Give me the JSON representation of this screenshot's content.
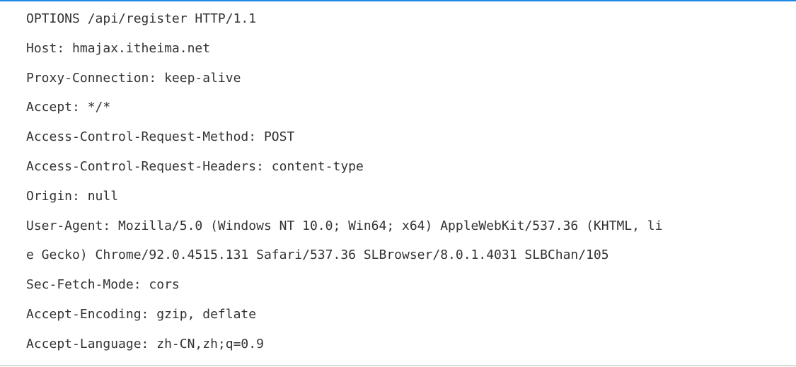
{
  "request": {
    "lines": [
      "OPTIONS /api/register HTTP/1.1",
      "Host: hmajax.itheima.net",
      "Proxy-Connection: keep-alive",
      "Accept: */*",
      "Access-Control-Request-Method: POST",
      "Access-Control-Request-Headers: content-type",
      "Origin: null",
      "User-Agent: Mozilla/5.0 (Windows NT 10.0; Win64; x64) AppleWebKit/537.36 (KHTML, li",
      "e Gecko) Chrome/92.0.4515.131 Safari/537.36 SLBrowser/8.0.1.4031 SLBChan/105",
      "Sec-Fetch-Mode: cors",
      "Accept-Encoding: gzip, deflate",
      "Accept-Language: zh-CN,zh;q=0.9"
    ]
  },
  "colors": {
    "top_rule": "#1e88e5",
    "bottom_rule": "#d9d9d9",
    "text": "#333333",
    "background": "#ffffff"
  }
}
